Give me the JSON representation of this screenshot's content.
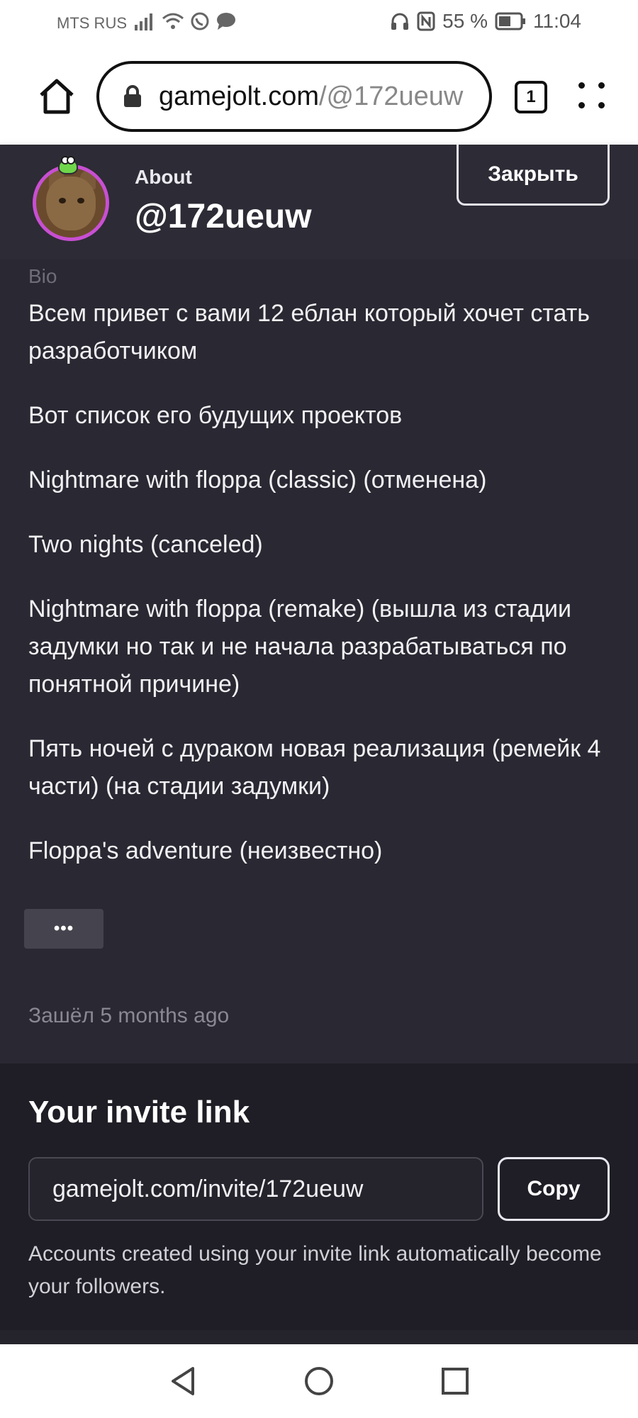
{
  "status_bar": {
    "carrier": "MTS RUS",
    "battery": "55 %",
    "time": "11:04"
  },
  "browser": {
    "url_host": "gamejolt.com",
    "url_path": "/@172ueuw",
    "tab_count": "1"
  },
  "header": {
    "about_label": "About",
    "username": "@172ueuw",
    "close_label": "Закрыть"
  },
  "bio": {
    "label": "Bio",
    "paragraphs": [
      "Всем привет с вами 12 еблан который хочет стать разработчиком",
      "Вот список его будущих проектов",
      "Nightmare with floppa (classic) (отменена)",
      "Two nights (canceled)",
      "Nightmare with floppa (remake) (вышла из стадии задумки но так и не начала разрабатываться по понятной причине)",
      "Пять ночей с дураком новая реализация (ремейк 4 части) (на стадии задумки)",
      "Floppa's adventure (неизвестно)"
    ],
    "more_label": "•••",
    "last_seen": "Зашёл 5 months ago"
  },
  "invite": {
    "title": "Your invite link",
    "link": "gamejolt.com/invite/172ueuw",
    "copy_label": "Copy",
    "note": "Accounts created using your invite link automatically become your followers."
  }
}
